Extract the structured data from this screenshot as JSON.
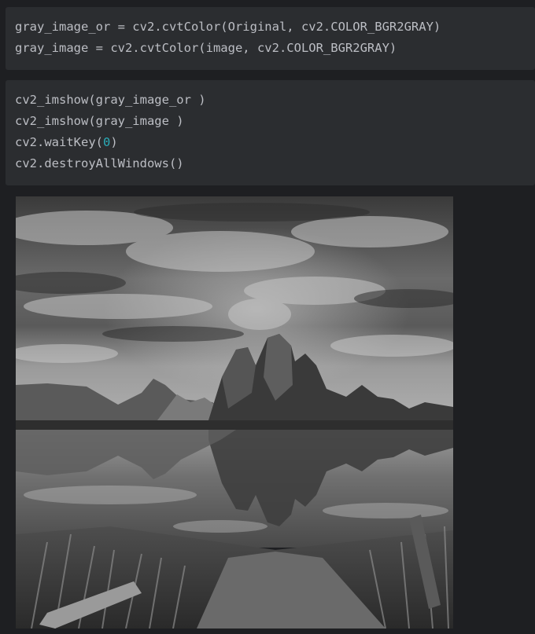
{
  "cells": [
    {
      "lines": [
        "gray_image_or = cv2.cvtColor(Original, cv2.COLOR_BGR2GRAY)",
        "gray_image = cv2.cvtColor(image, cv2.COLOR_BGR2GRAY)"
      ]
    },
    {
      "lines": [
        "cv2_imshow(gray_image_or )",
        "cv2_imshow(gray_image )",
        {
          "before": "cv2.waitKey(",
          "number": "0",
          "after": ")"
        },
        "cv2.destroyAllWindows()"
      ]
    }
  ],
  "colors": {
    "background": "#1e1f22",
    "cell_background": "#2b2d30",
    "code_text": "#bcbec4",
    "number_literal": "#2aacb8"
  },
  "output": {
    "type": "image",
    "content": "grayscale landscape photo"
  }
}
